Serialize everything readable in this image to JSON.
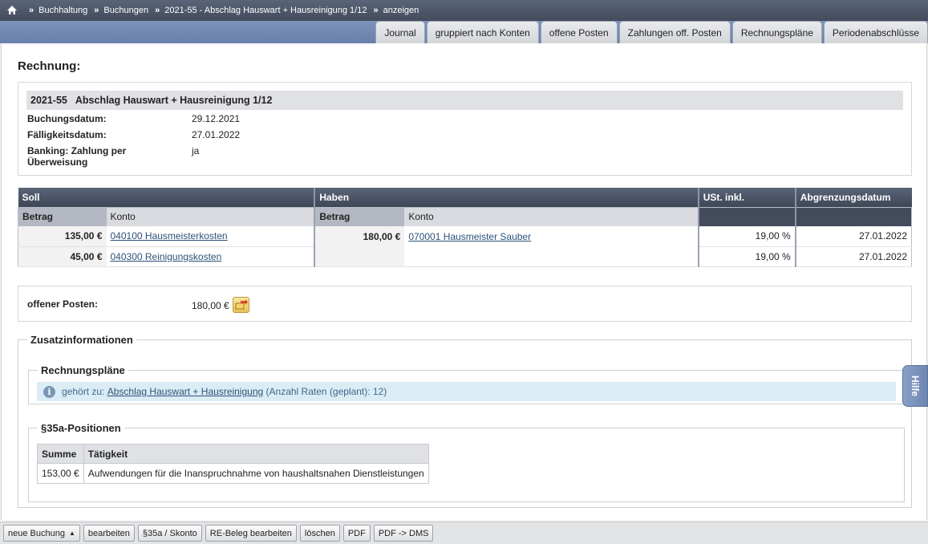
{
  "breadcrumb": {
    "items": [
      "Buchhaltung",
      "Buchungen",
      "2021-55 - Abschlag Hauswart + Hausreinigung 1/12",
      "anzeigen"
    ],
    "separator": "»"
  },
  "tabs": [
    "Journal",
    "gruppiert nach Konten",
    "offene Posten",
    "Zahlungen off. Posten",
    "Rechnungspläne",
    "Periodenabschlüsse"
  ],
  "page_title": "Rechnung:",
  "invoice": {
    "number": "2021-55",
    "title": "Abschlag Hauswart + Hausreinigung 1/12",
    "booking_date_label": "Buchungsdatum:",
    "booking_date": "29.12.2021",
    "due_date_label": "Fälligkeitsdatum:",
    "due_date": "27.01.2022",
    "banking_label_line1": "Banking: Zahlung per",
    "banking_label_line2": "Überweisung",
    "banking_value": "ja"
  },
  "booking_table": {
    "headers": {
      "soll": "Soll",
      "haben": "Haben",
      "ust": "USt. inkl.",
      "abgrenzung": "Abgrenzungsdatum"
    },
    "subheaders": {
      "betrag": "Betrag",
      "konto": "Konto"
    },
    "soll_rows": [
      {
        "amount": "135,00 €",
        "account": "040100 Hausmeisterkosten"
      },
      {
        "amount": "45,00 €",
        "account": "040300 Reinigungskosten"
      }
    ],
    "haben": {
      "amount": "180,00 €",
      "account": "070001 Hausmeister Sauber"
    },
    "vat_rows": [
      "19,00 %",
      "19,00 %"
    ],
    "date_rows": [
      "27.01.2022",
      "27.01.2022"
    ]
  },
  "open_item": {
    "label": "offener Posten:",
    "value": "180,00 €"
  },
  "zusatz": {
    "legend": "Zusatzinformationen",
    "plans_legend": "Rechnungspläne",
    "plan_prefix": "gehört zu:",
    "plan_link": "Abschlag Hauswart + Hausreinigung",
    "plan_suffix": "(Anzahl Raten (geplant): 12)",
    "s35_legend": "§35a-Positionen",
    "s35_headers": [
      "Summe",
      "Tätigkeit"
    ],
    "s35_rows": [
      {
        "sum": "153,00 €",
        "activity": "Aufwendungen für die Inanspruchnahme von haushaltsnahen Dienstleistungen"
      }
    ]
  },
  "help_label": "Hilfe",
  "toolbar": {
    "new_booking": "neue Buchung",
    "edit": "bearbeiten",
    "s35_skonto": "§35a / Skonto",
    "re_beleg": "RE-Beleg bearbeiten",
    "delete": "löschen",
    "pdf": "PDF",
    "pdf_dms": "PDF -> DMS"
  },
  "colors": {
    "header_dark": "#434b5c",
    "tabbar": "#7289b4",
    "link": "#2c5378",
    "info_bg": "#dcecf5"
  }
}
